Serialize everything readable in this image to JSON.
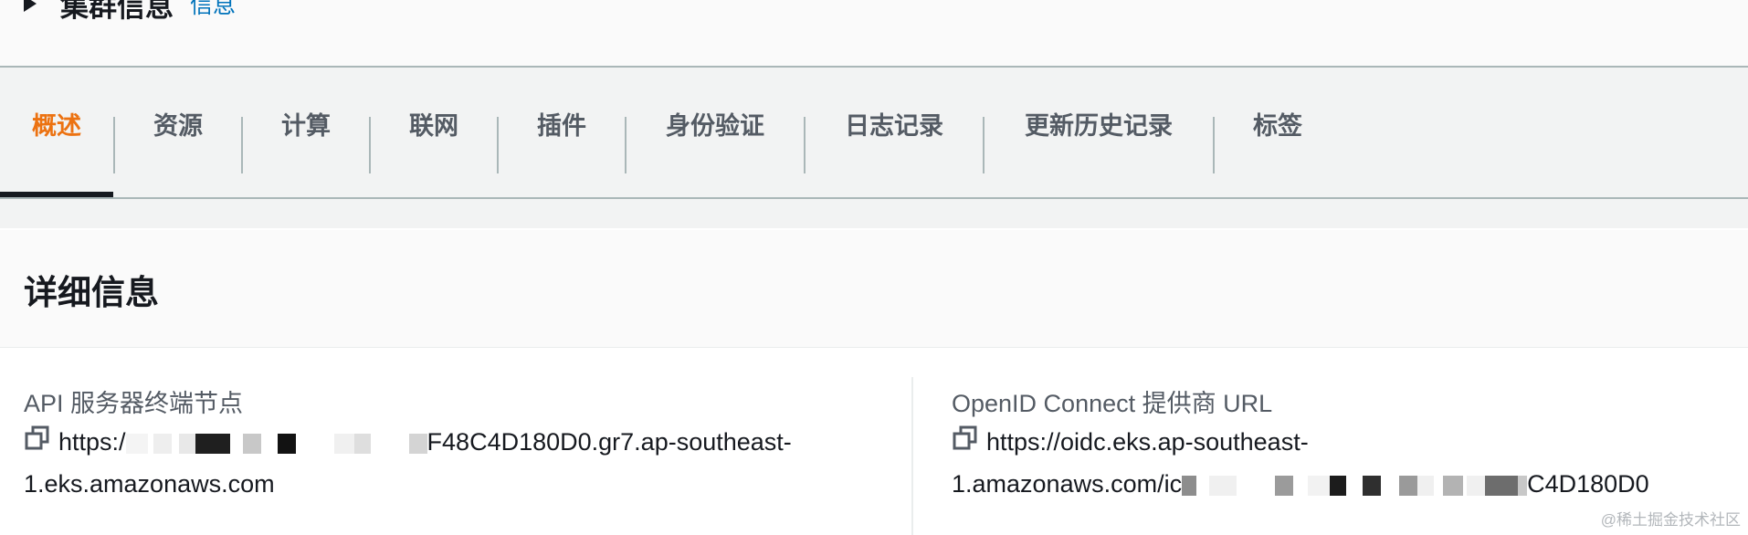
{
  "cluster": {
    "title": "集群信息",
    "info_link": "信息"
  },
  "tabs": [
    {
      "label": "概述",
      "active": true
    },
    {
      "label": "资源"
    },
    {
      "label": "计算"
    },
    {
      "label": "联网"
    },
    {
      "label": "插件"
    },
    {
      "label": "身份验证"
    },
    {
      "label": "日志记录"
    },
    {
      "label": "更新历史记录"
    },
    {
      "label": "标签"
    }
  ],
  "details": {
    "title": "详细信息",
    "api_endpoint": {
      "label": "API 服务器终端节点",
      "value_prefix": "https:/",
      "value_suffix_line1": "F48C4D180D0.gr7.ap-southeast-",
      "value_line2": "1.eks.amazonaws.com"
    },
    "oidc": {
      "label": "OpenID Connect 提供商 URL",
      "value_line1": "https://oidc.eks.ap-southeast-",
      "value_line2_prefix": "1.amazonaws.com/ic",
      "value_line2_suffix": "C4D180D0"
    }
  },
  "watermark": "@稀土掘金技术社区",
  "colors": {
    "accent": "#ec7211",
    "link": "#0073bb",
    "text": "#16191f",
    "muted": "#545b64"
  }
}
